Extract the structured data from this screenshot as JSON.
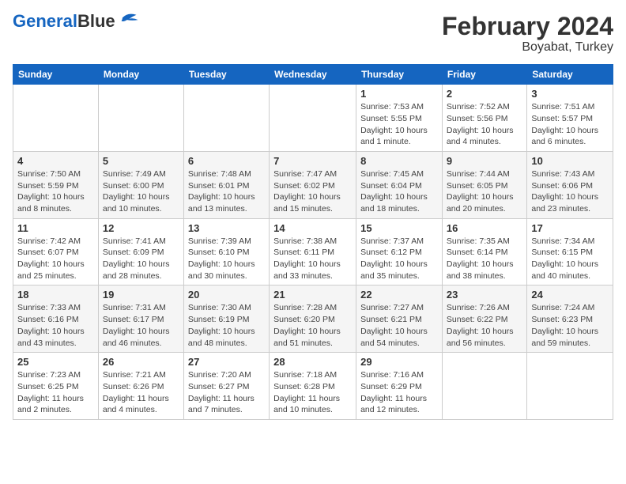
{
  "logo": {
    "line1": "General",
    "line2": "Blue"
  },
  "title": "February 2024",
  "subtitle": "Boyabat, Turkey",
  "weekdays": [
    "Sunday",
    "Monday",
    "Tuesday",
    "Wednesday",
    "Thursday",
    "Friday",
    "Saturday"
  ],
  "weeks": [
    [
      {
        "day": "",
        "info": ""
      },
      {
        "day": "",
        "info": ""
      },
      {
        "day": "",
        "info": ""
      },
      {
        "day": "",
        "info": ""
      },
      {
        "day": "1",
        "info": "Sunrise: 7:53 AM\nSunset: 5:55 PM\nDaylight: 10 hours and 1 minute."
      },
      {
        "day": "2",
        "info": "Sunrise: 7:52 AM\nSunset: 5:56 PM\nDaylight: 10 hours and 4 minutes."
      },
      {
        "day": "3",
        "info": "Sunrise: 7:51 AM\nSunset: 5:57 PM\nDaylight: 10 hours and 6 minutes."
      }
    ],
    [
      {
        "day": "4",
        "info": "Sunrise: 7:50 AM\nSunset: 5:59 PM\nDaylight: 10 hours and 8 minutes."
      },
      {
        "day": "5",
        "info": "Sunrise: 7:49 AM\nSunset: 6:00 PM\nDaylight: 10 hours and 10 minutes."
      },
      {
        "day": "6",
        "info": "Sunrise: 7:48 AM\nSunset: 6:01 PM\nDaylight: 10 hours and 13 minutes."
      },
      {
        "day": "7",
        "info": "Sunrise: 7:47 AM\nSunset: 6:02 PM\nDaylight: 10 hours and 15 minutes."
      },
      {
        "day": "8",
        "info": "Sunrise: 7:45 AM\nSunset: 6:04 PM\nDaylight: 10 hours and 18 minutes."
      },
      {
        "day": "9",
        "info": "Sunrise: 7:44 AM\nSunset: 6:05 PM\nDaylight: 10 hours and 20 minutes."
      },
      {
        "day": "10",
        "info": "Sunrise: 7:43 AM\nSunset: 6:06 PM\nDaylight: 10 hours and 23 minutes."
      }
    ],
    [
      {
        "day": "11",
        "info": "Sunrise: 7:42 AM\nSunset: 6:07 PM\nDaylight: 10 hours and 25 minutes."
      },
      {
        "day": "12",
        "info": "Sunrise: 7:41 AM\nSunset: 6:09 PM\nDaylight: 10 hours and 28 minutes."
      },
      {
        "day": "13",
        "info": "Sunrise: 7:39 AM\nSunset: 6:10 PM\nDaylight: 10 hours and 30 minutes."
      },
      {
        "day": "14",
        "info": "Sunrise: 7:38 AM\nSunset: 6:11 PM\nDaylight: 10 hours and 33 minutes."
      },
      {
        "day": "15",
        "info": "Sunrise: 7:37 AM\nSunset: 6:12 PM\nDaylight: 10 hours and 35 minutes."
      },
      {
        "day": "16",
        "info": "Sunrise: 7:35 AM\nSunset: 6:14 PM\nDaylight: 10 hours and 38 minutes."
      },
      {
        "day": "17",
        "info": "Sunrise: 7:34 AM\nSunset: 6:15 PM\nDaylight: 10 hours and 40 minutes."
      }
    ],
    [
      {
        "day": "18",
        "info": "Sunrise: 7:33 AM\nSunset: 6:16 PM\nDaylight: 10 hours and 43 minutes."
      },
      {
        "day": "19",
        "info": "Sunrise: 7:31 AM\nSunset: 6:17 PM\nDaylight: 10 hours and 46 minutes."
      },
      {
        "day": "20",
        "info": "Sunrise: 7:30 AM\nSunset: 6:19 PM\nDaylight: 10 hours and 48 minutes."
      },
      {
        "day": "21",
        "info": "Sunrise: 7:28 AM\nSunset: 6:20 PM\nDaylight: 10 hours and 51 minutes."
      },
      {
        "day": "22",
        "info": "Sunrise: 7:27 AM\nSunset: 6:21 PM\nDaylight: 10 hours and 54 minutes."
      },
      {
        "day": "23",
        "info": "Sunrise: 7:26 AM\nSunset: 6:22 PM\nDaylight: 10 hours and 56 minutes."
      },
      {
        "day": "24",
        "info": "Sunrise: 7:24 AM\nSunset: 6:23 PM\nDaylight: 10 hours and 59 minutes."
      }
    ],
    [
      {
        "day": "25",
        "info": "Sunrise: 7:23 AM\nSunset: 6:25 PM\nDaylight: 11 hours and 2 minutes."
      },
      {
        "day": "26",
        "info": "Sunrise: 7:21 AM\nSunset: 6:26 PM\nDaylight: 11 hours and 4 minutes."
      },
      {
        "day": "27",
        "info": "Sunrise: 7:20 AM\nSunset: 6:27 PM\nDaylight: 11 hours and 7 minutes."
      },
      {
        "day": "28",
        "info": "Sunrise: 7:18 AM\nSunset: 6:28 PM\nDaylight: 11 hours and 10 minutes."
      },
      {
        "day": "29",
        "info": "Sunrise: 7:16 AM\nSunset: 6:29 PM\nDaylight: 11 hours and 12 minutes."
      },
      {
        "day": "",
        "info": ""
      },
      {
        "day": "",
        "info": ""
      }
    ]
  ]
}
